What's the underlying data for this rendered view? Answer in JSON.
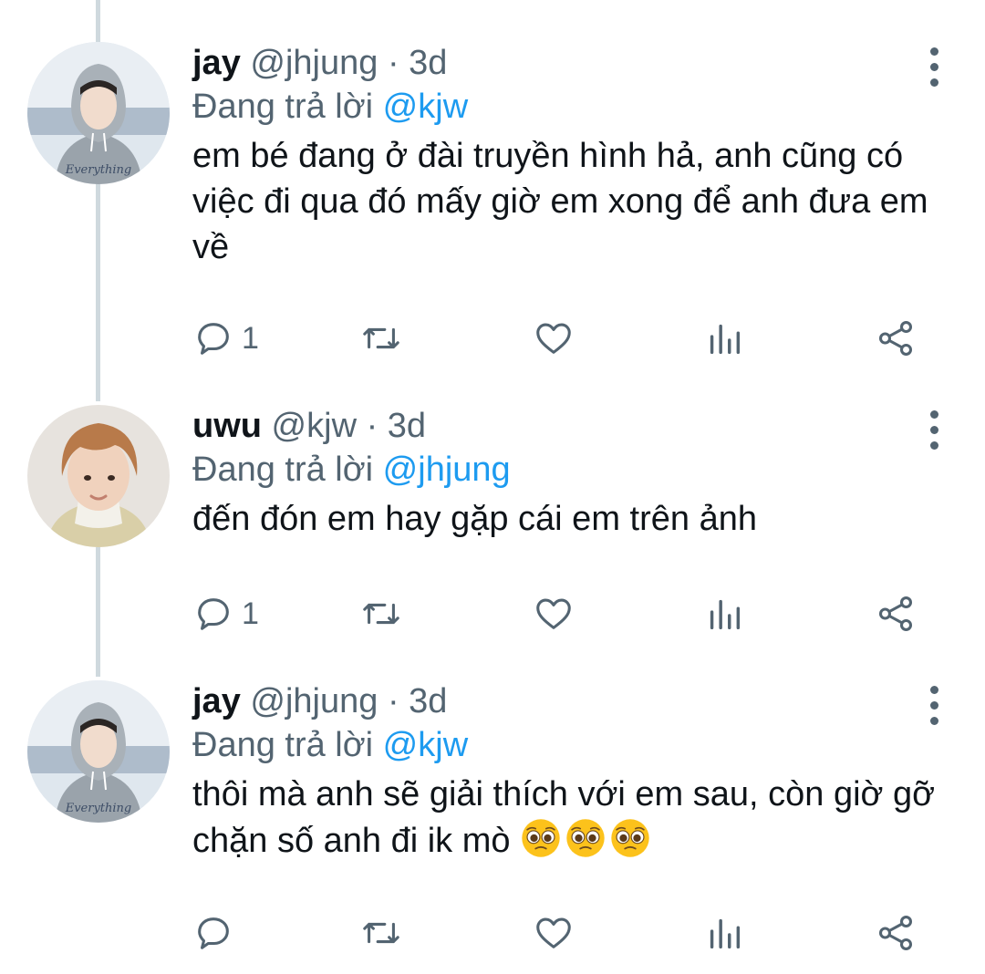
{
  "tweets": [
    {
      "name": "jay",
      "handle": "@jhjung",
      "separator": "·",
      "time": "3d",
      "reply_prefix": "Đang trả lời",
      "reply_to": "@kjw",
      "text": "em bé đang ở đài truyền hình hả, anh cũng có việc đi qua đó mấy giờ em xong để anh đưa em về",
      "reply_count": "1",
      "avatar_caption": "Everything"
    },
    {
      "name": "uwu",
      "handle": "@kjw",
      "separator": "·",
      "time": "3d",
      "reply_prefix": "Đang trả lời",
      "reply_to": "@jhjung",
      "text": "đến đón em hay gặp cái em trên ảnh",
      "reply_count": "1"
    },
    {
      "name": "jay",
      "handle": "@jhjung",
      "separator": "·",
      "time": "3d",
      "reply_prefix": "Đang trả lời",
      "reply_to": "@kjw",
      "text": "thôi mà anh sẽ giải thích với em sau, còn giờ gỡ chặn số anh đi ik mò",
      "emoji": [
        "pleading-face",
        "pleading-face",
        "pleading-face"
      ],
      "reply_count": "",
      "avatar_caption": "Everything"
    }
  ],
  "colors": {
    "text": "#0f1419",
    "muted": "#536471",
    "link": "#1d9bf0",
    "thread_line": "#cfd9de"
  },
  "icons": [
    "more-icon",
    "reply-icon",
    "retweet-icon",
    "like-icon",
    "stats-icon",
    "share-icon"
  ]
}
